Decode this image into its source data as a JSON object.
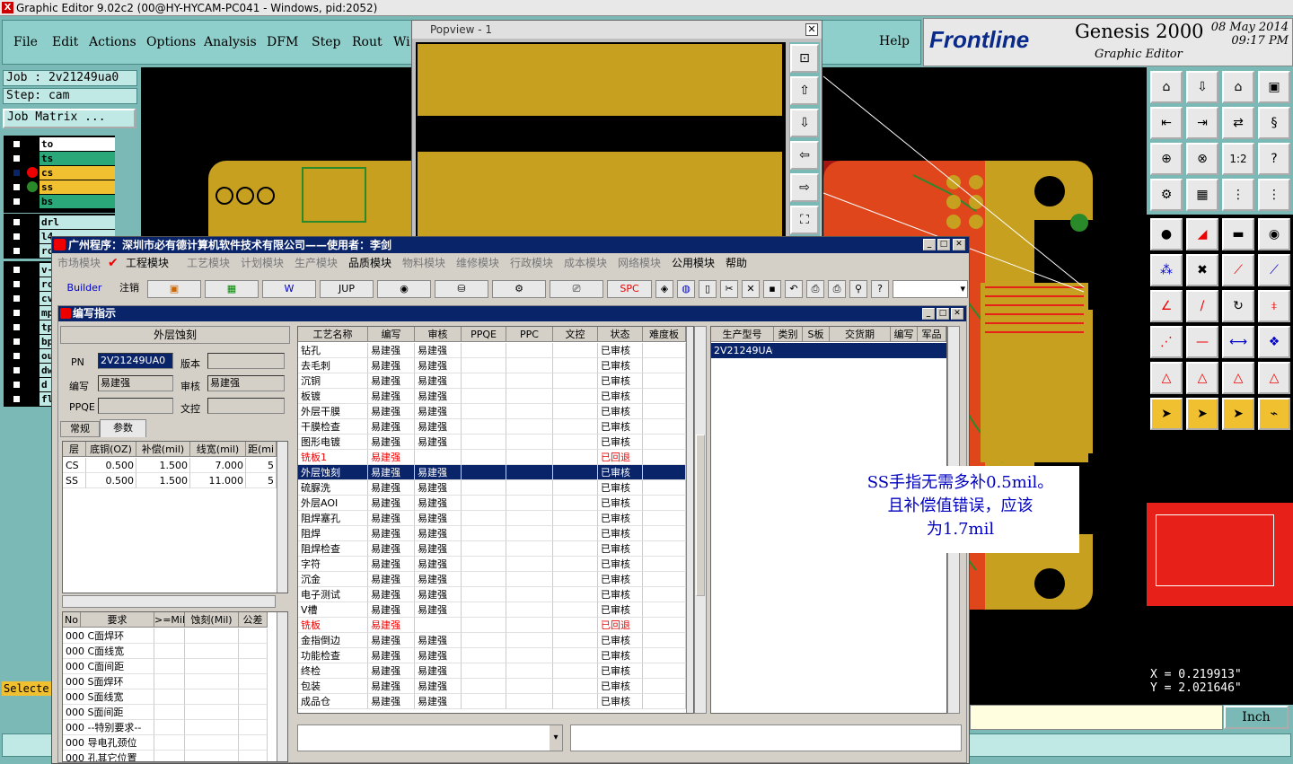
{
  "genesis": {
    "window_title": "Graphic Editor 9.02c2 (00@HY-HYCAM-PC041 - Windows, pid:2052)",
    "menu": [
      "File",
      "Edit",
      "Actions",
      "Options",
      "Analysis",
      "DFM",
      "Step",
      "Rout",
      "Wi"
    ],
    "help": "Help",
    "logo": "Frontline",
    "product": "Genesis 2000",
    "subtitle": "Graphic Editor",
    "date": "08 May 2014",
    "time": "09:17 PM",
    "job": "Job : 2v21249ua0",
    "step": "Step: cam",
    "job_matrix": "Job Matrix ...",
    "layers_top": [
      {
        "name": "to",
        "color": "#ffffff"
      },
      {
        "name": "ts",
        "color": "#2aa87a"
      },
      {
        "name": "cs",
        "color": "#f0c030"
      },
      {
        "name": "ss",
        "color": "#f0c030"
      },
      {
        "name": "bs",
        "color": "#2aa87a"
      }
    ],
    "layers_mid": [
      "drl",
      "l4",
      "rc"
    ],
    "layers_bottom": [
      "v-",
      "rc",
      "cv",
      "mp",
      "tp",
      "bp",
      "ou",
      "dw",
      "d",
      "fl"
    ],
    "selected_label": "Selecte",
    "coord_x": "X = 0.219913\"",
    "coord_y": "Y = 2.021646\"",
    "units": "Inch"
  },
  "popview": {
    "title": "Popview - 1"
  },
  "erp": {
    "title": "广州程序：深圳市必有德计算机软件技术有限公司——使用者：李剑",
    "menu": [
      "市场模块",
      "工程模块",
      "工艺模块",
      "计划模块",
      "生产模块",
      "品质模块",
      "物料模块",
      "维修模块",
      "行政模块",
      "成本模块",
      "网络模块",
      "公用模块",
      "帮助"
    ],
    "toolbar": [
      "Builder",
      "注销",
      "",
      "",
      "",
      "JUP",
      "",
      "",
      "",
      "",
      "SPC"
    ],
    "sub_title": "编写指示",
    "section": "外层蚀刻",
    "pn_label": "PN",
    "pn_value": "2V21249UA0",
    "version_label": "版本",
    "writer_label": "编写",
    "writer_value": "易建强",
    "review_label": "审核",
    "review_value": "易建强",
    "ppqe_label": "PPQE",
    "doc_label": "文控",
    "tabs": [
      "常规",
      "参数"
    ],
    "param_headers": [
      "层",
      "底铜(OZ)",
      "补偿(mil)",
      "线宽(mil)",
      "距(mi"
    ],
    "params": [
      [
        "CS",
        "0.500",
        "1.500",
        "7.000",
        "5"
      ],
      [
        "SS",
        "0.500",
        "1.500",
        "11.000",
        "5"
      ]
    ],
    "req_headers": [
      "No",
      "要求",
      ">=Mil",
      "蚀刻(Mil)",
      "公差"
    ],
    "requirements": [
      "000 C面焊环",
      "000 C面线宽",
      "000 C面间距",
      "000 S面焊环",
      "000 S面线宽",
      "000 S面间距",
      "000 --特别要求--",
      "000 导电孔颈位",
      "000 孔其它位置"
    ],
    "proc_headers": [
      "工艺名称",
      "编写",
      "审核",
      "PPQE",
      "PPC",
      "文控",
      "状态",
      "难度板"
    ],
    "processes": [
      {
        "name": "钻孔",
        "w": "易建强",
        "r": "易建强",
        "s": "已审核"
      },
      {
        "name": "去毛刺",
        "w": "易建强",
        "r": "易建强",
        "s": "已审核"
      },
      {
        "name": "沉铜",
        "w": "易建强",
        "r": "易建强",
        "s": "已审核"
      },
      {
        "name": "板镀",
        "w": "易建强",
        "r": "易建强",
        "s": "已审核"
      },
      {
        "name": "外层干膜",
        "w": "易建强",
        "r": "易建强",
        "s": "已审核"
      },
      {
        "name": "干膜检查",
        "w": "易建强",
        "r": "易建强",
        "s": "已审核"
      },
      {
        "name": "图形电镀",
        "w": "易建强",
        "r": "易建强",
        "s": "已审核"
      },
      {
        "name": "铣板1",
        "w": "易建强",
        "r": "",
        "s": "已回退",
        "red": true
      },
      {
        "name": "外层蚀刻",
        "w": "易建强",
        "r": "易建强",
        "s": "已审核",
        "sel": true
      },
      {
        "name": "硫脲洗",
        "w": "易建强",
        "r": "易建强",
        "s": "已审核"
      },
      {
        "name": "外层AOI",
        "w": "易建强",
        "r": "易建强",
        "s": "已审核"
      },
      {
        "name": "阻焊塞孔",
        "w": "易建强",
        "r": "易建强",
        "s": "已审核"
      },
      {
        "name": "阻焊",
        "w": "易建强",
        "r": "易建强",
        "s": "已审核"
      },
      {
        "name": "阻焊检查",
        "w": "易建强",
        "r": "易建强",
        "s": "已审核"
      },
      {
        "name": "字符",
        "w": "易建强",
        "r": "易建强",
        "s": "已审核"
      },
      {
        "name": "沉金",
        "w": "易建强",
        "r": "易建强",
        "s": "已审核"
      },
      {
        "name": "电子测试",
        "w": "易建强",
        "r": "易建强",
        "s": "已审核"
      },
      {
        "name": "V槽",
        "w": "易建强",
        "r": "易建强",
        "s": "已审核"
      },
      {
        "name": "铣板",
        "w": "易建强",
        "r": "",
        "s": "已回退",
        "red": true
      },
      {
        "name": "金指倒边",
        "w": "易建强",
        "r": "易建强",
        "s": "已审核"
      },
      {
        "name": "功能检查",
        "w": "易建强",
        "r": "易建强",
        "s": "已审核"
      },
      {
        "name": "终检",
        "w": "易建强",
        "r": "易建强",
        "s": "已审核"
      },
      {
        "name": "包装",
        "w": "易建强",
        "r": "易建强",
        "s": "已审核"
      },
      {
        "name": "成品仓",
        "w": "易建强",
        "r": "易建强",
        "s": "已审核"
      }
    ],
    "right_headers": [
      "生产型号",
      "类别",
      "S板",
      "交货期",
      "编写",
      "军品"
    ],
    "right_rows": [
      [
        "2V21249UA0",
        "",
        "",
        "",
        "",
        ""
      ]
    ]
  },
  "annotation": {
    "line1": "SS手指无需多补0.5mil。",
    "line2": "且补偿值错误，应该",
    "line3": "为1.7mil"
  }
}
